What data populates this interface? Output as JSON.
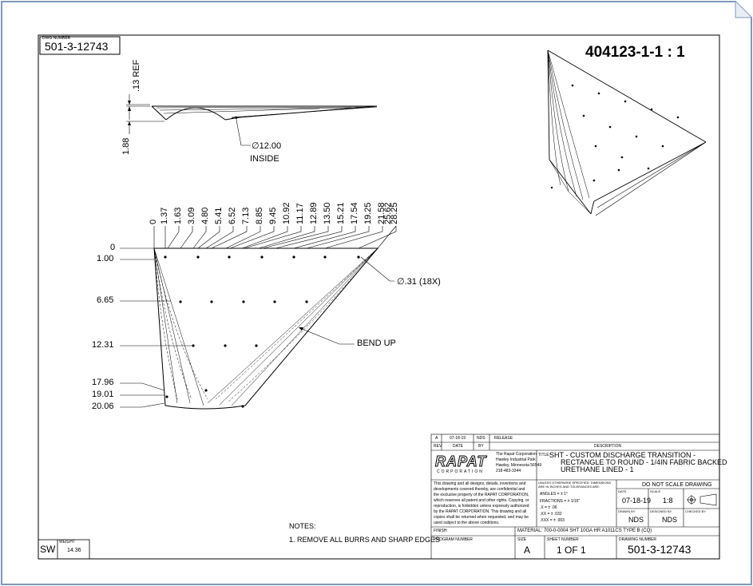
{
  "title_block": {
    "dwg_number_label": "DWG NUMBER",
    "dwg_number": "501-3-12743",
    "sw_label": "SW",
    "weight_label": "WEIGHT",
    "weight": "14.36",
    "revision": {
      "rev": "A",
      "date": "07-18-19",
      "by": "NDS",
      "description": "RELEASE"
    },
    "rev_headers": {
      "rev": "REV",
      "date": "DATE",
      "by": "BY",
      "description": "DESCRIPTION"
    },
    "company_logo": "RAPAT",
    "company_logo_sub": "CORPORATION",
    "company_address": [
      "The Rapat Corporation",
      "Hawley Industrial Park",
      "Hawley, Minnesota 56549",
      "218-483-3344"
    ],
    "title_label": "TITLE:",
    "title_lines": [
      "SHT - CUSTOM DISCHARGE TRANSITION -",
      "RECTANGLE TO ROUND - 1/4IN FABRIC BACKED",
      "URETHANE LINED - 1"
    ],
    "proprietary_text": [
      "This drawing and all designs, details, inventions and",
      "developments covered thereby, are confidential and",
      "the exclusive property of the RAPAT CORPORATION,",
      "which reserves all patent and other rights. Copying, or",
      "reproduction, is forbidden unless expressly authorized",
      "by the RAPAT CORPORATION. This drawing and all",
      "copies shall be returned when requested, and may be",
      "used subject to the above conditions."
    ],
    "tolerance_header": [
      "UNLESS OTHERWISE SPECIFIED: DIMENSIONS",
      "ARE IN INCHES AND TOLERANCES ARE:"
    ],
    "tolerances": [
      "ANGLES = ± 1°",
      "FRACTIONS = ± 1/16\"",
      ".X = ± .06",
      ".XX = ± .032",
      ".XXX = ± .003"
    ],
    "do_not_scale": "DO NOT SCALE DRAWING",
    "date_label": "DATE",
    "date": "07-18-19",
    "scale_label": "SCALE",
    "scale": "1:8",
    "drawn_by_label": "DRAWN BY",
    "drawn_by": "NDS",
    "designed_by_label": "DESIGNED BY",
    "designed_by": "NDS",
    "checked_by_label": "CHECKED BY",
    "finish_label": "FINISH:",
    "material": "MATERIAL: 700-0-0004 SHT 10GA HR A1011CS TYPE B (CQ)",
    "program_number_label": "PROGRAM NUMBER",
    "size_label": "SIZE",
    "size": "A",
    "sheet_number_label": "SHEET NUMBER",
    "sheet_number": "1 OF 1",
    "drawing_number_label": "DRAWING NUMBER",
    "drawing_number": "501-3-12743"
  },
  "part_label": "404123-1-1 : 1",
  "notes": {
    "heading": "NOTES:",
    "items": [
      "1. REMOVE ALL BURRS AND SHARP EDGES"
    ]
  },
  "side_view": {
    "ref_dim": ".13 REF",
    "height_dim": "1.88",
    "diameter_callout": "∅12.00",
    "diameter_sub": "INSIDE"
  },
  "flat_pattern": {
    "x_dims": [
      "0",
      "1.37",
      "1.63",
      "3.09",
      "4.80",
      "5.41",
      "6.52",
      "7.13",
      "8.85",
      "9.45",
      "10.92",
      "11.17",
      "12.89",
      "13.50",
      "15.21",
      "17.54",
      "19.25",
      "21.58",
      "25.62",
      "28.25"
    ],
    "y_dims": [
      "0",
      "1.00",
      "6.65",
      "12.31",
      "17.96",
      "19.01",
      "20.06"
    ],
    "hole_callout": "∅.31 (18X)",
    "bend_callout": "BEND UP"
  }
}
